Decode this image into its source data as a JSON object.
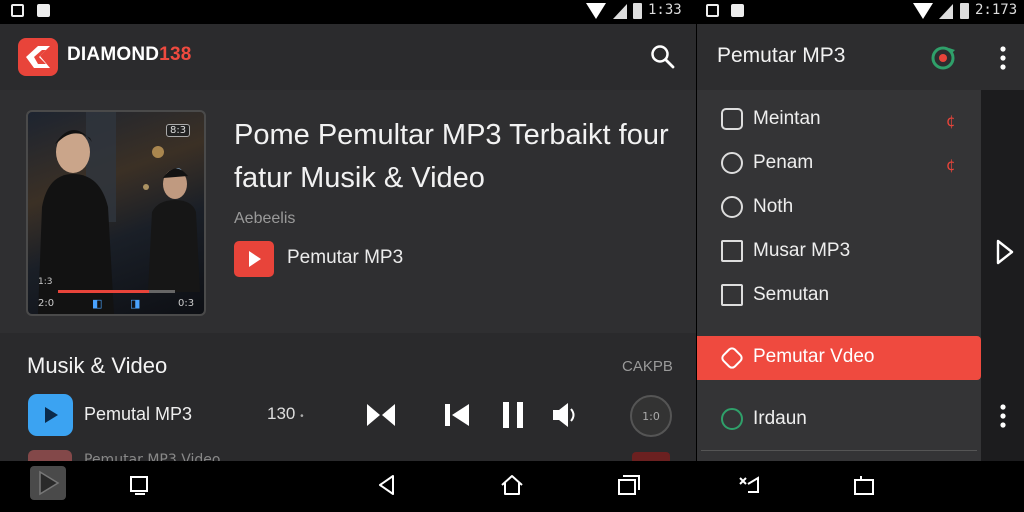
{
  "status_left": {
    "time": "1:33"
  },
  "status_right": {
    "time": "2:173"
  },
  "app": {
    "brand_word": "DIAMOND",
    "brand_num": "138"
  },
  "hero": {
    "title": "Pome Pemultar MP3 Terbaikt four fatur Musik & Video",
    "subtitle": "Aebeelis",
    "badge_label": "Pemutar MP3"
  },
  "album": {
    "tl_badge": "8:3",
    "left_time": "2:0",
    "right_time": "0:3",
    "small_left": "1:3",
    "progress_fraction": 0.78
  },
  "section": {
    "title": "Musik & Video",
    "right_label": "CAKPB",
    "track1_label": "Pemutal MP3",
    "track1_num": "130",
    "track1_marker": "•",
    "round_btn_label": "1:0",
    "track2_label": "Pemutar MP3 Video"
  },
  "drawer": {
    "title": "Pemutar MP3",
    "items": [
      {
        "label": "Meintan",
        "icon": "edit-icon",
        "mark": "¢"
      },
      {
        "label": "Penam",
        "icon": "spiral-icon",
        "mark": "¢"
      },
      {
        "label": "Noth",
        "icon": "circle-icon",
        "mark": ""
      },
      {
        "label": "Musar MP3",
        "icon": "equalizer-icon",
        "mark": ""
      },
      {
        "label": "Semutan",
        "icon": "note-icon",
        "mark": ""
      },
      {
        "label": "Pemutar Vdeo",
        "icon": "video-icon",
        "mark": ""
      },
      {
        "label": "Irdaun",
        "icon": "search-icon",
        "mark": ""
      }
    ]
  },
  "colors": {
    "accent": "#ef4a3f",
    "track_icon": "#3ba3f2",
    "drawer_accent_icon": "#2fa06a"
  }
}
